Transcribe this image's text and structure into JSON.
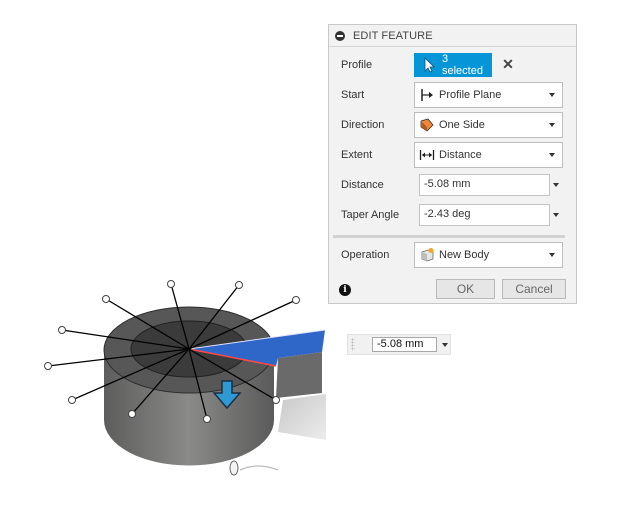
{
  "dialog": {
    "title": "EDIT FEATURE",
    "profile": {
      "label": "Profile",
      "value": "3 selected"
    },
    "start": {
      "label": "Start",
      "value": "Profile Plane"
    },
    "direction": {
      "label": "Direction",
      "value": "One Side"
    },
    "extent": {
      "label": "Extent",
      "value": "Distance"
    },
    "distance": {
      "label": "Distance",
      "value": "-5.08 mm"
    },
    "taper": {
      "label": "Taper Angle",
      "value": "-2.43 deg"
    },
    "operation": {
      "label": "Operation",
      "value": "New Body"
    },
    "ok_label": "OK",
    "cancel_label": "Cancel"
  },
  "viewport": {
    "dimension_input": "-5.08 mm"
  },
  "colors": {
    "accent": "#0696d7",
    "face_highlight": "#2f67c9",
    "body_gray": "#6f6f6f"
  }
}
